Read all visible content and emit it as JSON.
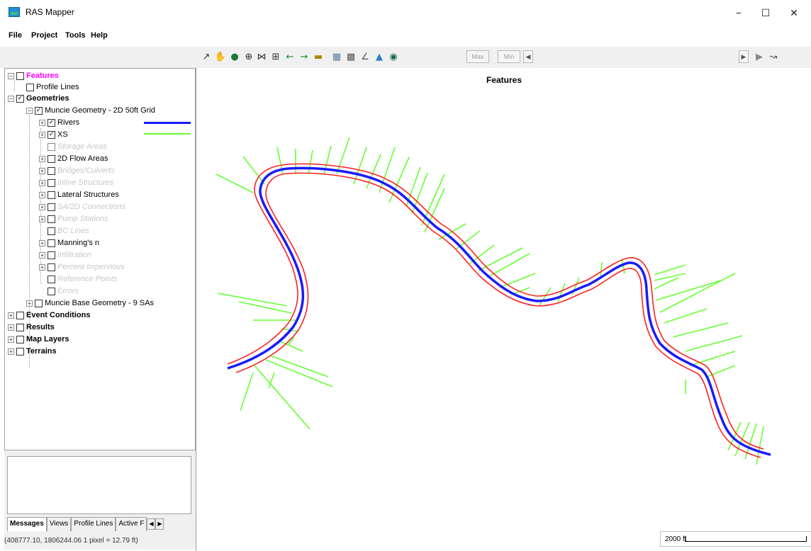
{
  "window": {
    "title": "RAS Mapper",
    "minimize": "−",
    "maximize": "☐",
    "close": "✕"
  },
  "menu": [
    "File",
    "Project",
    "Tools",
    "Help"
  ],
  "toolbar": {
    "max_label": "Max",
    "min_label": "Min"
  },
  "tree": {
    "features": "Features",
    "profile_lines": "Profile Lines",
    "geometries": "Geometries",
    "muncie_geometry": "Muncie Geometry - 2D 50ft Grid",
    "rivers": "Rivers",
    "xs": "XS",
    "storage_areas": "Storage Areas",
    "flow_areas_2d": "2D Flow Areas",
    "bridges_culverts": "Bridges/Culverts",
    "inline_structures": "Inline Structures",
    "lateral_structures": "Lateral Structures",
    "sa2d_connections": "SA/2D Connections",
    "pump_stations": "Pump Stations",
    "bc_lines": "BC Lines",
    "mannings_n": "Manning's n",
    "infiltration": "Infiltration",
    "percent_impervious": "Percent Impervious",
    "reference_points": "Reference Points",
    "errors": "Errors",
    "muncie_base": "Muncie Base Geometry - 9 SAs",
    "event_conditions": "Event Conditions",
    "results": "Results",
    "map_layers": "Map Layers",
    "terrains": "Terrains"
  },
  "legend_colors": {
    "rivers": "#1a1aff",
    "xs": "#66ff33",
    "banks": "#ff2020"
  },
  "tabs": [
    "Messages",
    "Views",
    "Profile Lines",
    "Active F"
  ],
  "status": "(408777.10, 1806244.06  1 pixel = 12.79 ft)",
  "map": {
    "title": "Features",
    "scale_label": "2000 ft"
  }
}
